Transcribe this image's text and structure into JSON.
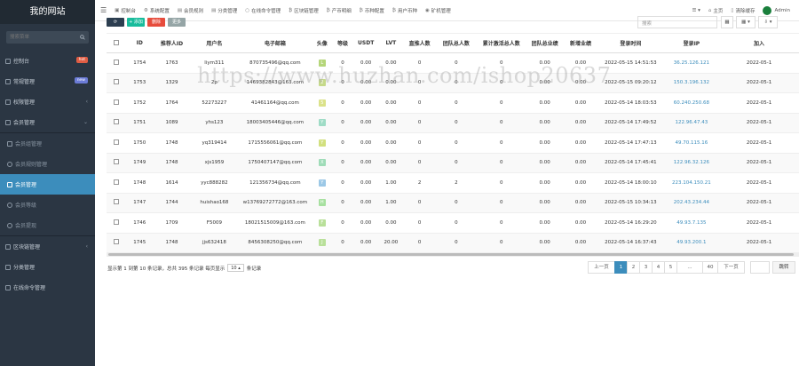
{
  "sidebar": {
    "logo": "我的网站",
    "search_placeholder": "搜索菜单",
    "items": [
      {
        "label": "控制台",
        "badge": "hot",
        "badge_color": "#e05d44",
        "icon": "dashboard-icon"
      },
      {
        "label": "常规管理",
        "badge": "new",
        "badge_color": "#6b7bd6",
        "icon": "gear-icon"
      },
      {
        "label": "权限管理",
        "chevron": "‹",
        "icon": "group-icon"
      },
      {
        "label": "会员管理",
        "chevron": "⌄",
        "icon": "user-icon"
      },
      {
        "label": "会员组管理",
        "sub": true,
        "icon": "users-icon"
      },
      {
        "label": "会员规则管理",
        "sub": true,
        "icon": "circle-icon"
      },
      {
        "label": "会员管理",
        "sub": true,
        "active": true,
        "icon": "user-icon"
      },
      {
        "label": "会员等级",
        "sub": true,
        "icon": "circle-icon"
      },
      {
        "label": "会员提现",
        "sub": true,
        "icon": "circle-icon"
      },
      {
        "label": "区块链管理",
        "chevron": "‹",
        "icon": "list-icon"
      },
      {
        "label": "分类管理",
        "icon": "list-icon"
      },
      {
        "label": "在线命令管理",
        "icon": "terminal-icon"
      }
    ]
  },
  "topbar": {
    "tabs": [
      {
        "label": "控制台",
        "icon": "▣"
      },
      {
        "label": "系统配置",
        "icon": "⚙"
      },
      {
        "label": "会员规则",
        "icon": "▤"
      },
      {
        "label": "分类管理",
        "icon": "▤"
      },
      {
        "label": "在线命令管理",
        "icon": "○"
      },
      {
        "label": "区块链管理",
        "icon": "₿"
      },
      {
        "label": "产币明细",
        "icon": "₿"
      },
      {
        "label": "币种配置",
        "icon": "₿"
      },
      {
        "label": "用户币种",
        "icon": "₿"
      },
      {
        "label": "矿机管理",
        "icon": "◉"
      }
    ],
    "right": {
      "home": "主页",
      "clear": "清除缓存",
      "user": "Admin"
    }
  },
  "toolbar": {
    "buttons": [
      {
        "label": "⟳",
        "color": "#2c3e50"
      },
      {
        "label": "+ 添加",
        "color": "#18bc9c"
      },
      {
        "label": "删除",
        "color": "#e74c3c"
      },
      {
        "label": "更多",
        "color": "#95a5a6"
      }
    ],
    "search_placeholder": "搜索",
    "ctrl_labels": [
      "▦",
      "▦ ▾",
      "⇩ ▾"
    ]
  },
  "table": {
    "headers": [
      "ID",
      "推荐人ID",
      "用户名",
      "电子邮箱",
      "头像",
      "等级",
      "USDT",
      "LVT",
      "直推人数",
      "团队总人数",
      "累计激活总人数",
      "团队总业绩",
      "新增业绩",
      "登录时间",
      "登录IP",
      "加入"
    ],
    "rows": [
      {
        "id": "1754",
        "ref": "1763",
        "user": "liym311",
        "email": "870735496@qq.com",
        "av": "L",
        "avc": "#b5d67a",
        "lvl": "0",
        "usdt": "0.00",
        "lvt": "0.00",
        "direct": "0",
        "team": "0",
        "act": "0",
        "perf": "0.00",
        "new": "0.00",
        "time": "2022-05-15 14:51:53",
        "ip": "36.25.126.121",
        "join": "2022-05-1"
      },
      {
        "id": "1753",
        "ref": "1329",
        "user": "2p",
        "email": "1469382843@163.com",
        "av": "2",
        "avc": "#c5d98a",
        "lvl": "0",
        "usdt": "0.00",
        "lvt": "0.00",
        "direct": "0",
        "team": "0",
        "act": "0",
        "perf": "0.00",
        "new": "0.00",
        "time": "2022-05-15 09:20:12",
        "ip": "150.3.196.132",
        "join": "2022-05-1"
      },
      {
        "id": "1752",
        "ref": "1764",
        "user": "52273227",
        "email": "41461164@qq.com",
        "av": "5",
        "avc": "#dbe28a",
        "lvl": "0",
        "usdt": "0.00",
        "lvt": "0.00",
        "direct": "0",
        "team": "0",
        "act": "0",
        "perf": "0.00",
        "new": "0.00",
        "time": "2022-05-14 18:03:53",
        "ip": "60.240.250.68",
        "join": "2022-05-1"
      },
      {
        "id": "1751",
        "ref": "1089",
        "user": "yhs123",
        "email": "18003405446@qq.com",
        "av": "Y",
        "avc": "#9fdcc6",
        "lvl": "0",
        "usdt": "0.00",
        "lvt": "0.00",
        "direct": "0",
        "team": "0",
        "act": "0",
        "perf": "0.00",
        "new": "0.00",
        "time": "2022-05-14 17:49:52",
        "ip": "122.96.47.43",
        "join": "2022-05-1"
      },
      {
        "id": "1750",
        "ref": "1748",
        "user": "yq319414",
        "email": "1715556061@qq.com",
        "av": "Y",
        "avc": "#d2e07f",
        "lvl": "0",
        "usdt": "0.00",
        "lvt": "0.00",
        "direct": "0",
        "team": "0",
        "act": "0",
        "perf": "0.00",
        "new": "0.00",
        "time": "2022-05-14 17:47:13",
        "ip": "49.70.115.16",
        "join": "2022-05-1"
      },
      {
        "id": "1749",
        "ref": "1748",
        "user": "xjs1959",
        "email": "1750407147@qq.com",
        "av": "X",
        "avc": "#9fdcb8",
        "lvl": "0",
        "usdt": "0.00",
        "lvt": "0.00",
        "direct": "0",
        "team": "0",
        "act": "0",
        "perf": "0.00",
        "new": "0.00",
        "time": "2022-05-14 17:45:41",
        "ip": "122.96.32.126",
        "join": "2022-05-1"
      },
      {
        "id": "1748",
        "ref": "1614",
        "user": "yyc888282",
        "email": "121356734@qq.com",
        "av": "Y",
        "avc": "#9cc8e6",
        "lvl": "0",
        "usdt": "0.00",
        "lvt": "1.00",
        "direct": "2",
        "team": "2",
        "act": "0",
        "perf": "0.00",
        "new": "0.00",
        "time": "2022-05-14 18:00:10",
        "ip": "223.104.150.21",
        "join": "2022-05-1"
      },
      {
        "id": "1747",
        "ref": "1744",
        "user": "huishao168",
        "email": "w13769272772@163.com",
        "av": "H",
        "avc": "#a7e0a0",
        "lvl": "0",
        "usdt": "0.00",
        "lvt": "1.00",
        "direct": "0",
        "team": "0",
        "act": "0",
        "perf": "0.00",
        "new": "0.00",
        "time": "2022-05-15 10:34:13",
        "ip": "202.43.234.44",
        "join": "2022-05-1"
      },
      {
        "id": "1746",
        "ref": "1709",
        "user": "F5009",
        "email": "18021515009@163.com",
        "av": "F",
        "avc": "#b9e09a",
        "lvl": "0",
        "usdt": "0.00",
        "lvt": "0.00",
        "direct": "0",
        "team": "0",
        "act": "0",
        "perf": "0.00",
        "new": "0.00",
        "time": "2022-05-14 16:29:20",
        "ip": "49.93.7.135",
        "join": "2022-05-1"
      },
      {
        "id": "1745",
        "ref": "1748",
        "user": "jjs632418",
        "email": "8456308250@qq.com",
        "av": "J",
        "avc": "#b9e09a",
        "lvl": "0",
        "usdt": "0.00",
        "lvt": "20.00",
        "direct": "0",
        "team": "0",
        "act": "0",
        "perf": "0.00",
        "new": "0.00",
        "time": "2022-05-14 16:37:43",
        "ip": "49.93.200.1",
        "join": "2022-05-1"
      }
    ]
  },
  "footer": {
    "info_before": "显示第 1 到第 10 条记录，总共 395 条记录 每页显示",
    "page_size": "10 ▴",
    "info_after": "条记录",
    "prev": "上一页",
    "pages": [
      "1",
      "2",
      "3",
      "4",
      "5",
      "...",
      "40"
    ],
    "next": "下一页",
    "jump": "跳转"
  },
  "watermark": "https://www.huzhan.com/ishop20637"
}
